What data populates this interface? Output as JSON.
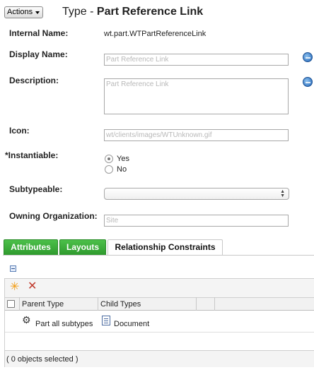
{
  "header": {
    "actions_label": "Actions",
    "title_prefix": "Type - ",
    "title_name": "Part Reference Link"
  },
  "form": {
    "internal_name": {
      "label": "Internal Name:",
      "value": "wt.part.WTPartReferenceLink"
    },
    "display_name": {
      "label": "Display Name:",
      "value": "Part Reference Link"
    },
    "description": {
      "label": "Description:",
      "value": "Part Reference Link"
    },
    "icon": {
      "label": "Icon:",
      "value": "wt/clients/images/WTUnknown.gif"
    },
    "instantiable": {
      "required_mark": "*",
      "label": "Instantiable:",
      "options": [
        "Yes",
        "No"
      ],
      "selected": "Yes"
    },
    "subtypeable": {
      "label": "Subtypeable:",
      "value": ""
    },
    "owning_org": {
      "label": "Owning Organization:",
      "value": "Site"
    }
  },
  "tabs": [
    {
      "label": "Attributes",
      "active": false
    },
    {
      "label": "Layouts",
      "active": false
    },
    {
      "label": "Relationship Constraints",
      "active": true
    }
  ],
  "table": {
    "columns": [
      "Parent Type",
      "Child Types"
    ],
    "rows": [
      {
        "parent": "Part all subtypes",
        "child": "Document"
      }
    ],
    "footer": "( 0 objects selected )"
  },
  "colors": {
    "tab_green": "#3aad39",
    "delete_red": "#c0392b",
    "new_orange": "#f39c12",
    "globe_blue": "#1f63b6"
  }
}
